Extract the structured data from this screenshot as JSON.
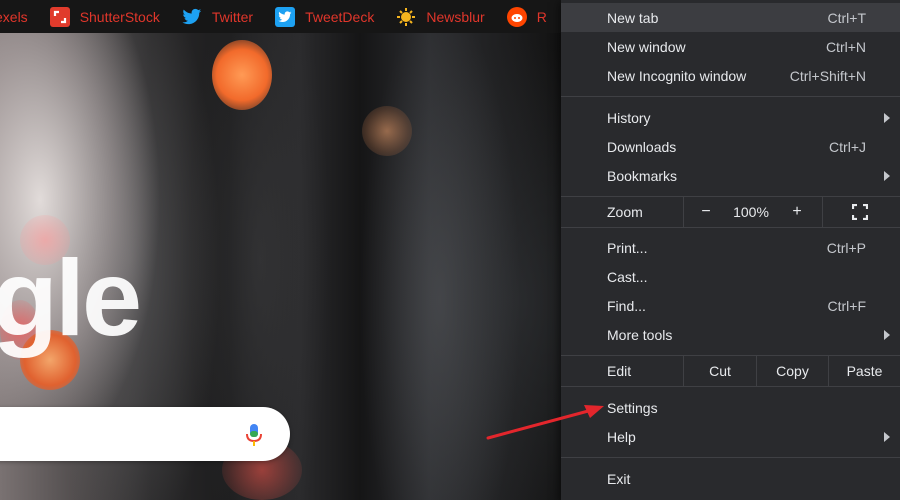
{
  "bookmarks": [
    {
      "label": "exels",
      "icon": "pexels-icon"
    },
    {
      "label": "ShutterStock",
      "icon": "shutterstock-icon"
    },
    {
      "label": "Twitter",
      "icon": "twitter-icon"
    },
    {
      "label": "TweetDeck",
      "icon": "tweetdeck-icon"
    },
    {
      "label": "Newsblur",
      "icon": "newsblur-icon"
    },
    {
      "label": "R",
      "icon": "reddit-icon"
    }
  ],
  "background": {
    "logo_fragment": "gle"
  },
  "menu": {
    "new_tab": {
      "label": "New tab",
      "shortcut": "Ctrl+T"
    },
    "new_window": {
      "label": "New window",
      "shortcut": "Ctrl+N"
    },
    "new_incognito": {
      "label": "New Incognito window",
      "shortcut": "Ctrl+Shift+N"
    },
    "history": {
      "label": "History"
    },
    "downloads": {
      "label": "Downloads",
      "shortcut": "Ctrl+J"
    },
    "bookmarks": {
      "label": "Bookmarks"
    },
    "zoom": {
      "label": "Zoom",
      "minus": "−",
      "value": "100%",
      "plus": "+"
    },
    "print": {
      "label": "Print...",
      "shortcut": "Ctrl+P"
    },
    "cast": {
      "label": "Cast..."
    },
    "find": {
      "label": "Find...",
      "shortcut": "Ctrl+F"
    },
    "more_tools": {
      "label": "More tools"
    },
    "edit": {
      "label": "Edit",
      "cut": "Cut",
      "copy": "Copy",
      "paste": "Paste"
    },
    "settings": {
      "label": "Settings"
    },
    "help": {
      "label": "Help"
    },
    "exit": {
      "label": "Exit"
    }
  },
  "colors": {
    "menu_bg": "#292a2d",
    "menu_highlight": "#3c3d41",
    "bookmark_text": "#e0362b",
    "annotation": "#e3262c"
  }
}
